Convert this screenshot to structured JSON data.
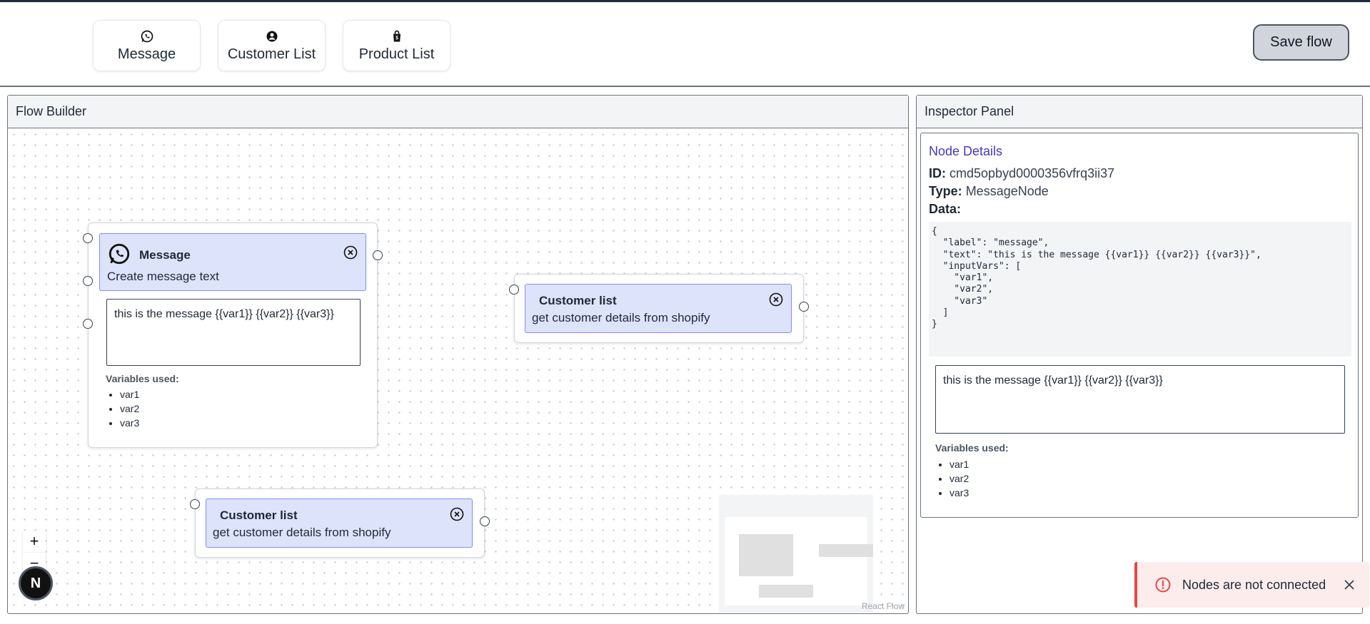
{
  "toolbar": {
    "tools": [
      {
        "label": "Message",
        "icon": "whatsapp-icon"
      },
      {
        "label": "Customer List",
        "icon": "user-circle-icon"
      },
      {
        "label": "Product List",
        "icon": "shopify-bag-icon"
      }
    ],
    "save_label": "Save flow"
  },
  "flow_builder": {
    "title": "Flow Builder",
    "attribution": "React Flow",
    "nodes": {
      "message": {
        "title": "Message",
        "subtitle": "Create message text",
        "text": "this is the message {{var1}} {{var2}} {{var3}}",
        "vars_title": "Variables used:",
        "vars": [
          "var1",
          "var2",
          "var3"
        ]
      },
      "customer_list_1": {
        "title": "Customer list",
        "subtitle": "get customer details from shopify"
      },
      "customer_list_2": {
        "title": "Customer list",
        "subtitle": "get customer details from shopify"
      }
    },
    "controls": {
      "zoom_in": "+",
      "zoom_out": "−",
      "fit": "⛶"
    },
    "badge": "N"
  },
  "inspector": {
    "title": "Inspector Panel",
    "details_title": "Node Details",
    "id_label": "ID:",
    "id_value": "cmd5opbyd0000356vfrq3ii37",
    "type_label": "Type:",
    "type_value": "MessageNode",
    "data_label": "Data:",
    "json_text": "{\n  \"label\": \"message\",\n  \"text\": \"this is the message {{var1}} {{var2}} {{var3}}\",\n  \"inputVars\": [\n    \"var1\",\n    \"var2\",\n    \"var3\"\n  ]\n}",
    "text": "this is the message {{var1}} {{var2}} {{var3}}",
    "vars_title": "Variables used:",
    "vars": [
      "var1",
      "var2",
      "var3"
    ]
  },
  "toast": {
    "text": "Nodes are not connected",
    "icon": "alert-circle-icon"
  },
  "colors": {
    "accent": "#4338ca",
    "node_header_bg": "#dde3fb",
    "node_header_border": "#818cf8",
    "toast_bg": "#fdecec",
    "toast_border": "#ef4444"
  }
}
